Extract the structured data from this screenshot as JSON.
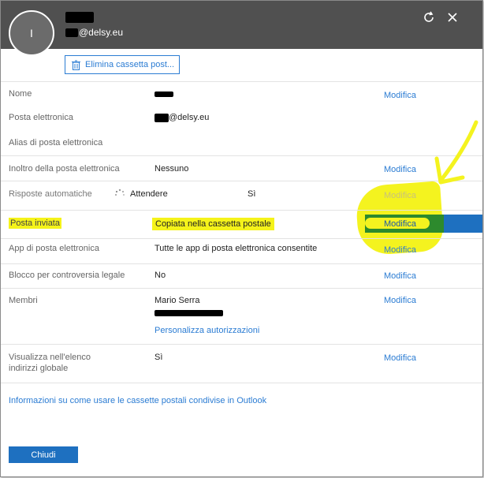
{
  "header": {
    "avatar_initial": "I",
    "email_suffix": "@delsy.eu",
    "refresh_icon": "refresh-icon",
    "close_icon": "close-icon"
  },
  "toolbar": {
    "delete_label": "Elimina cassetta post..."
  },
  "rows": [
    {
      "label": "Nome",
      "value": "",
      "action": "Modifica"
    },
    {
      "label": "Posta elettronica",
      "value": "@delsy.eu",
      "action": ""
    },
    {
      "label": "Alias di posta elettronica",
      "value": "",
      "action": ""
    },
    {
      "label": "Inoltro della posta elettronica",
      "value": "Nessuno",
      "action": "Modifica"
    },
    {
      "label": "Risposte automatiche",
      "status": "Attendere",
      "value": "Sì",
      "action": "Modifica"
    },
    {
      "label": "Posta inviata",
      "value": "Copiata nella cassetta postale",
      "action": "Modifica"
    },
    {
      "label": "App di posta elettronica",
      "value": "Tutte le app di posta elettronica consentite",
      "action": "Modifica"
    },
    {
      "label": "Blocco per controversia legale",
      "value": "No",
      "action": "Modifica"
    },
    {
      "label": "Membri",
      "value": "Mario Serra",
      "sub_link": "Personalizza autorizzazioni",
      "action": "Modifica"
    },
    {
      "label": "Visualizza nell'elenco indirizzi globale",
      "value": "Sì",
      "action": "Modifica"
    }
  ],
  "footer": {
    "info_link": "Informazioni su come usare le cassette postali condivise in Outlook",
    "close_label": "Chiudi"
  },
  "colors": {
    "header": "#505050",
    "accent": "#1e70c0",
    "highlight": "#f4f31f"
  }
}
